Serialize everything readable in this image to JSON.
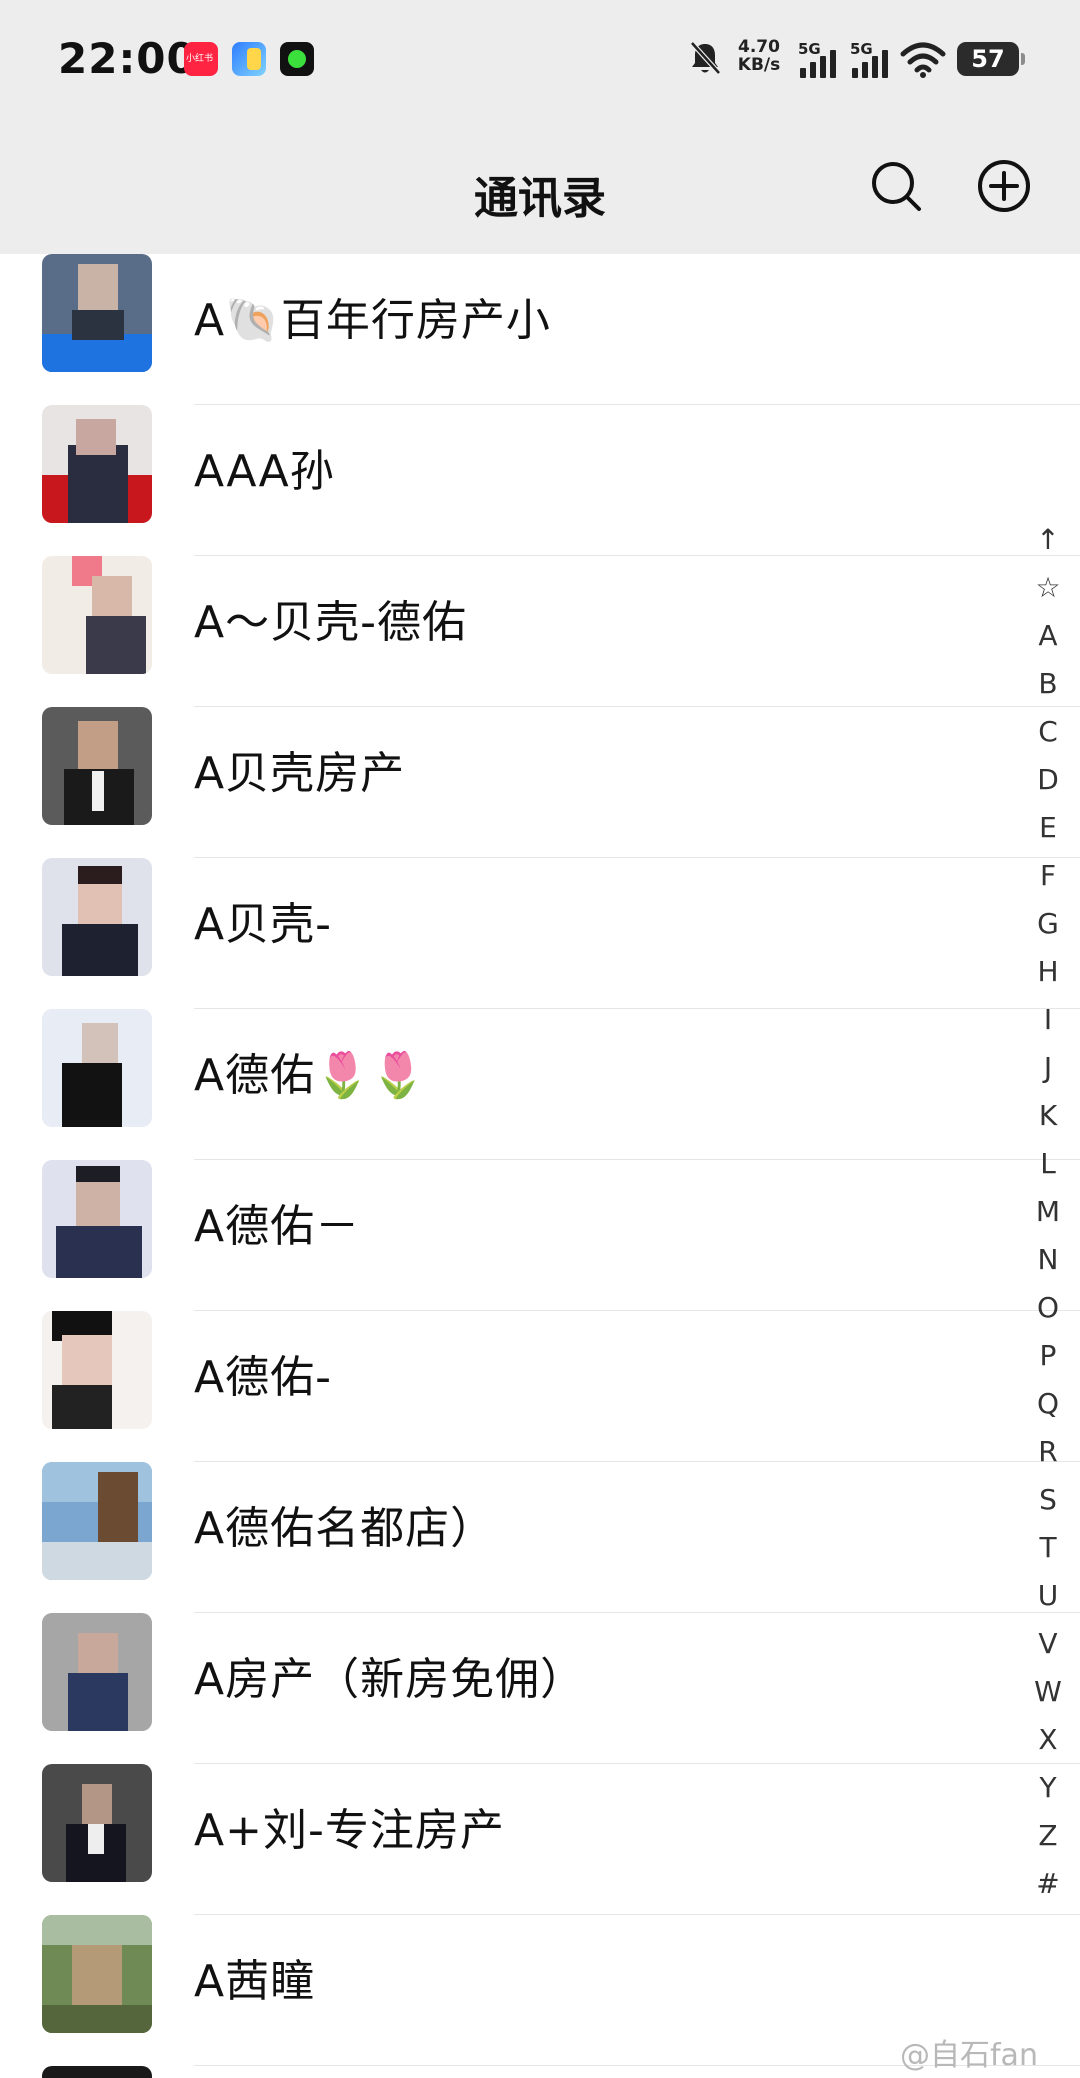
{
  "status_bar": {
    "time": "22:00",
    "app_icon_1_label": "小红书",
    "net_speed_value": "4.70",
    "net_speed_unit": "KB/s",
    "signal_1_label": "5G",
    "signal_2_label": "5G",
    "battery": "57",
    "icons": [
      "xiaohongshu-app-icon",
      "app-icon",
      "green-app-icon",
      "mute-bell-icon",
      "signal-icon",
      "wifi-icon",
      "battery-icon"
    ]
  },
  "header": {
    "title": "通讯录",
    "search_icon": "search-icon",
    "add_icon": "add-circle-icon"
  },
  "contacts": [
    {
      "name": "A🐚百年行房产小"
    },
    {
      "name": "AAA孙"
    },
    {
      "name": "A～贝壳-德佑"
    },
    {
      "name": "A贝壳房产"
    },
    {
      "name": "A贝壳-"
    },
    {
      "name": "A德佑🌷🌷"
    },
    {
      "name": "A德佑－"
    },
    {
      "name": "A德佑-"
    },
    {
      "name": "A德佑名都店）"
    },
    {
      "name": "A房产（新房免佣）"
    },
    {
      "name": "A+刘-专注房产"
    },
    {
      "name": "A茜瞳"
    }
  ],
  "index_bar": [
    "↑",
    "☆",
    "A",
    "B",
    "C",
    "D",
    "E",
    "F",
    "G",
    "H",
    "I",
    "J",
    "K",
    "L",
    "M",
    "N",
    "O",
    "P",
    "Q",
    "R",
    "S",
    "T",
    "U",
    "V",
    "W",
    "X",
    "Y",
    "Z",
    "#"
  ],
  "watermark": "@自石fan",
  "colors": {
    "header_bg": "#ededed",
    "list_bg": "#ffffff",
    "separator": "#e6e6e6",
    "text": "#111111"
  }
}
